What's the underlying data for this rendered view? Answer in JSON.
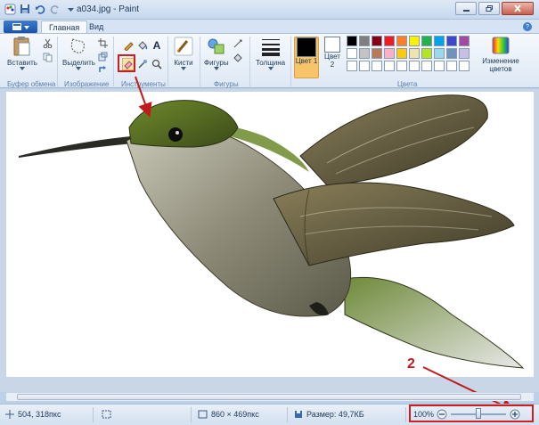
{
  "window": {
    "title": "a034.jpg - Paint"
  },
  "tabs": {
    "home": "Главная",
    "view": "Вид"
  },
  "ribbon": {
    "clipboard": {
      "paste": "Вставить",
      "group": "Буфер обмена"
    },
    "image": {
      "select": "Выделить",
      "group": "Изображение"
    },
    "tools": {
      "group": "Инструменты"
    },
    "brushes": {
      "label": "Кисти"
    },
    "shapes": {
      "label": "Фигуры",
      "group": "Фигуры"
    },
    "size": {
      "label": "Толщина"
    },
    "colors": {
      "color1": "Цвет 1",
      "color2": "Цвет 2",
      "edit": "Изменение цветов",
      "group": "Цвета",
      "color1_value": "#000000",
      "color2_value": "#ffffff",
      "palette_row1": [
        "#000000",
        "#7f7f7f",
        "#880015",
        "#ed1c24",
        "#ff7f27",
        "#fff200",
        "#22b14c",
        "#00a2e8",
        "#3f48cc",
        "#a349a4"
      ],
      "palette_row2": [
        "#ffffff",
        "#c3c3c3",
        "#b97a57",
        "#ffaec9",
        "#ffc90e",
        "#efe4b0",
        "#b5e61d",
        "#99d9ea",
        "#7092be",
        "#c8bfe7"
      ],
      "palette_row3": [
        "#ffffff",
        "#ffffff",
        "#ffffff",
        "#ffffff",
        "#ffffff",
        "#ffffff",
        "#ffffff",
        "#ffffff",
        "#ffffff",
        "#ffffff"
      ]
    }
  },
  "annotations": {
    "callout1": "1",
    "callout2": "2"
  },
  "status": {
    "cursor": "504, 318пкс",
    "dimensions": "860 × 469пкс",
    "filesize": "Размер: 49,7КБ",
    "zoom": "100%"
  },
  "icons": {
    "save": "save-icon",
    "undo": "undo-icon",
    "redo": "redo-icon",
    "eraser": "eraser-icon",
    "zoom_in": "zoom-in-icon",
    "zoom_out": "zoom-out-icon"
  }
}
